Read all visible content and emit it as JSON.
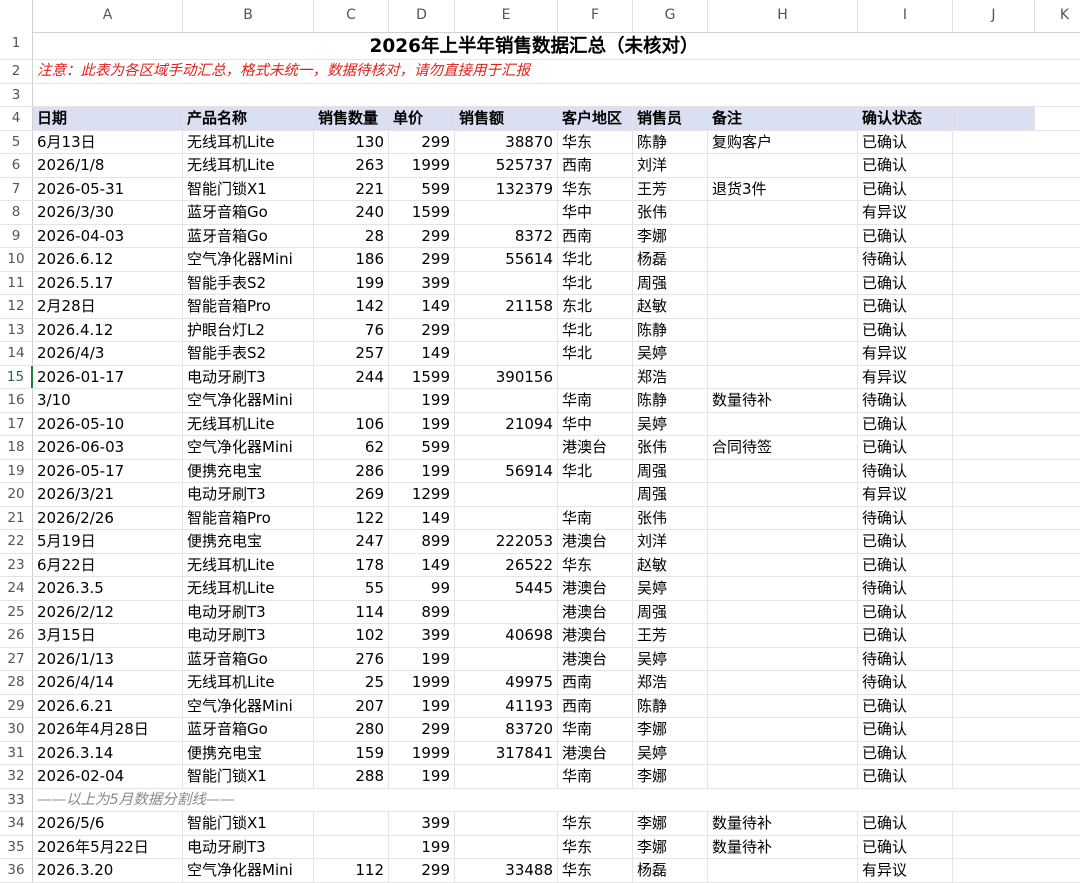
{
  "columns": [
    "A",
    "B",
    "C",
    "D",
    "E",
    "F",
    "G",
    "H",
    "I",
    "J",
    "K"
  ],
  "title": "2026年上半年销售数据汇总（未核对）",
  "note": "注意：此表为各区域手动汇总，格式未统一，数据待核对，请勿直接用于汇报",
  "headers": [
    "日期",
    "产品名称",
    "销售数量",
    "单价",
    "销售额",
    "客户地区",
    "销售员",
    "备注",
    "确认状态"
  ],
  "rows": [
    {
      "n": "5",
      "c": [
        "6月13日",
        "无线耳机Lite",
        "130",
        "299",
        "38870",
        "华东",
        "陈静",
        "复购客户",
        "已确认"
      ]
    },
    {
      "n": "6",
      "c": [
        "2026/1/8",
        "无线耳机Lite",
        "263",
        "1999",
        "525737",
        "西南",
        "刘洋",
        "",
        "已确认"
      ]
    },
    {
      "n": "7",
      "c": [
        "2026-05-31",
        "智能门锁X1",
        "221",
        "599",
        "132379",
        "华东",
        "王芳",
        "退货3件",
        "已确认"
      ]
    },
    {
      "n": "8",
      "c": [
        "2026/3/30",
        "蓝牙音箱Go",
        "240",
        "1599",
        "",
        "华中",
        "张伟",
        "",
        "有异议"
      ]
    },
    {
      "n": "9",
      "c": [
        "2026-04-03",
        "蓝牙音箱Go",
        "28",
        "299",
        "8372",
        "西南",
        "李娜",
        "",
        "已确认"
      ]
    },
    {
      "n": "10",
      "c": [
        "2026.6.12",
        "空气净化器Mini",
        "186",
        "299",
        "55614",
        "华北",
        "杨磊",
        "",
        "待确认"
      ]
    },
    {
      "n": "11",
      "c": [
        "2026.5.17",
        "智能手表S2",
        "199",
        "399",
        "",
        "华北",
        "周强",
        "",
        "已确认"
      ]
    },
    {
      "n": "12",
      "c": [
        "2月28日",
        "智能音箱Pro",
        "142",
        "149",
        "21158",
        "东北",
        "赵敏",
        "",
        "已确认"
      ]
    },
    {
      "n": "13",
      "c": [
        "2026.4.12",
        "护眼台灯L2",
        "76",
        "299",
        "",
        "华北",
        "陈静",
        "",
        "已确认"
      ]
    },
    {
      "n": "14",
      "c": [
        "2026/4/3",
        "智能手表S2",
        "257",
        "149",
        "",
        "华北",
        "吴婷",
        "",
        "有异议"
      ]
    },
    {
      "n": "15",
      "c": [
        "2026-01-17",
        "电动牙刷T3",
        "244",
        "1599",
        "390156",
        "",
        "郑浩",
        "",
        "有异议"
      ]
    },
    {
      "n": "16",
      "c": [
        "3/10",
        "空气净化器Mini",
        "",
        "199",
        "",
        "华南",
        "陈静",
        "数量待补",
        "待确认"
      ]
    },
    {
      "n": "17",
      "c": [
        "2026-05-10",
        "无线耳机Lite",
        "106",
        "199",
        "21094",
        "华中",
        "吴婷",
        "",
        "已确认"
      ]
    },
    {
      "n": "18",
      "c": [
        "2026-06-03",
        "空气净化器Mini",
        "62",
        "599",
        "",
        "港澳台",
        "张伟",
        "合同待签",
        "已确认"
      ]
    },
    {
      "n": "19",
      "c": [
        "2026-05-17",
        "便携充电宝",
        "286",
        "199",
        "56914",
        "华北",
        "周强",
        "",
        "待确认"
      ]
    },
    {
      "n": "20",
      "c": [
        "2026/3/21",
        "电动牙刷T3",
        "269",
        "1299",
        "",
        "",
        "周强",
        "",
        "有异议"
      ]
    },
    {
      "n": "21",
      "c": [
        "2026/2/26",
        "智能音箱Pro",
        "122",
        "149",
        "",
        "华南",
        "张伟",
        "",
        "待确认"
      ]
    },
    {
      "n": "22",
      "c": [
        "5月19日",
        "便携充电宝",
        "247",
        "899",
        "222053",
        "港澳台",
        "刘洋",
        "",
        "已确认"
      ]
    },
    {
      "n": "23",
      "c": [
        "6月22日",
        "无线耳机Lite",
        "178",
        "149",
        "26522",
        "华东",
        "赵敏",
        "",
        "已确认"
      ]
    },
    {
      "n": "24",
      "c": [
        "2026.3.5",
        "无线耳机Lite",
        "55",
        "99",
        "5445",
        "港澳台",
        "吴婷",
        "",
        "待确认"
      ]
    },
    {
      "n": "25",
      "c": [
        "2026/2/12",
        "电动牙刷T3",
        "114",
        "899",
        "",
        "港澳台",
        "周强",
        "",
        "已确认"
      ]
    },
    {
      "n": "26",
      "c": [
        "3月15日",
        "电动牙刷T3",
        "102",
        "399",
        "40698",
        "港澳台",
        "王芳",
        "",
        "已确认"
      ]
    },
    {
      "n": "27",
      "c": [
        "2026/1/13",
        "蓝牙音箱Go",
        "276",
        "199",
        "",
        "港澳台",
        "吴婷",
        "",
        "待确认"
      ]
    },
    {
      "n": "28",
      "c": [
        "2026/4/14",
        "无线耳机Lite",
        "25",
        "1999",
        "49975",
        "西南",
        "郑浩",
        "",
        "待确认"
      ]
    },
    {
      "n": "29",
      "c": [
        "2026.6.21",
        "空气净化器Mini",
        "207",
        "199",
        "41193",
        "西南",
        "陈静",
        "",
        "已确认"
      ]
    },
    {
      "n": "30",
      "c": [
        "2026年4月28日",
        "蓝牙音箱Go",
        "280",
        "299",
        "83720",
        "华南",
        "李娜",
        "",
        "已确认"
      ]
    },
    {
      "n": "31",
      "c": [
        "2026.3.14",
        "便携充电宝",
        "159",
        "1999",
        "317841",
        "港澳台",
        "吴婷",
        "",
        "已确认"
      ]
    },
    {
      "n": "32",
      "c": [
        "2026-02-04",
        "智能门锁X1",
        "288",
        "199",
        "",
        "华南",
        "李娜",
        "",
        "已确认"
      ]
    }
  ],
  "divider": "——以上为5月数据分割线——",
  "rows2": [
    {
      "n": "34",
      "c": [
        "2026/5/6",
        "智能门锁X1",
        "",
        "399",
        "",
        "华东",
        "李娜",
        "数量待补",
        "已确认"
      ]
    },
    {
      "n": "35",
      "c": [
        "2026年5月22日",
        "电动牙刷T3",
        "",
        "199",
        "",
        "华东",
        "李娜",
        "数量待补",
        "已确认"
      ]
    },
    {
      "n": "36",
      "c": [
        "2026.3.20",
        "空气净化器Mini",
        "112",
        "299",
        "33488",
        "华东",
        "杨磊",
        "",
        "有异议"
      ]
    }
  ],
  "row_numbers_static": [
    "1",
    "2",
    "3",
    "4",
    "33"
  ],
  "active_row": "15"
}
